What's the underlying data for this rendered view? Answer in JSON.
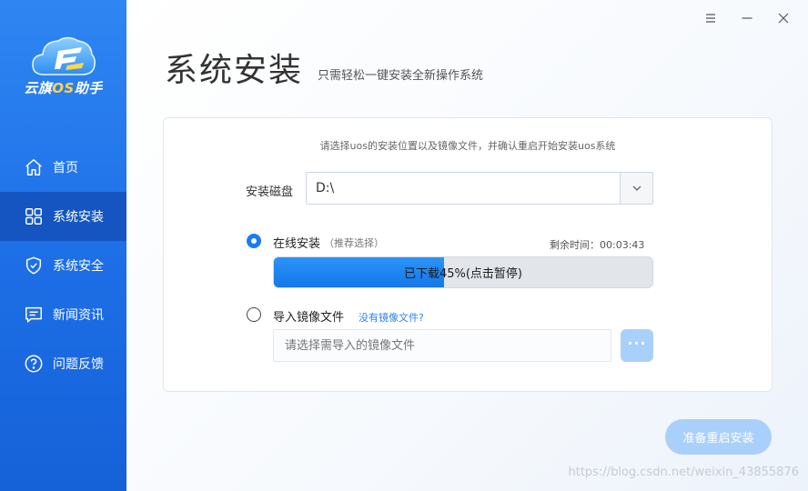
{
  "app": {
    "logo_text_prefix": "云旗",
    "logo_text_os": "OS",
    "logo_text_suffix": "助手"
  },
  "sidebar": {
    "items": [
      {
        "label": "首页",
        "icon": "home-icon",
        "active": false
      },
      {
        "label": "系统安装",
        "icon": "grid-icon",
        "active": true
      },
      {
        "label": "系统安全",
        "icon": "shield-icon",
        "active": false
      },
      {
        "label": "新闻资讯",
        "icon": "message-icon",
        "active": false
      },
      {
        "label": "问题反馈",
        "icon": "question-icon",
        "active": false
      }
    ]
  },
  "window_controls": [
    "menu-icon",
    "minimize-icon",
    "close-icon"
  ],
  "page": {
    "title": "系统安装",
    "subtitle": "只需轻松一键安装全新操作系统"
  },
  "card": {
    "hint": "请选择uos的安装位置以及镜像文件，并确认重启开始安装uos系统",
    "disk_label": "安装磁盘",
    "disk_value": "D:\\",
    "online": {
      "label": "在线安装",
      "sub": "（推荐选择）",
      "checked": true,
      "remaining": "剩余时间：00:03:43",
      "progress_percent": 45,
      "progress_text": "已下载45%(点击暂停)"
    },
    "import": {
      "label": "导入镜像文件",
      "link": "没有镜像文件?",
      "checked": false,
      "placeholder": "请选择需导入的镜像文件",
      "browse_label": "···"
    }
  },
  "actions": {
    "restart_install": "准备重启安装"
  },
  "watermark": "https://blog.csdn.net/weixin_43855876",
  "colors": {
    "sidebar": "#1d6ee6",
    "sidebar_active": "#1455c2",
    "accent": "#1a7cf0",
    "button_disabled": "#a9d0fb"
  }
}
